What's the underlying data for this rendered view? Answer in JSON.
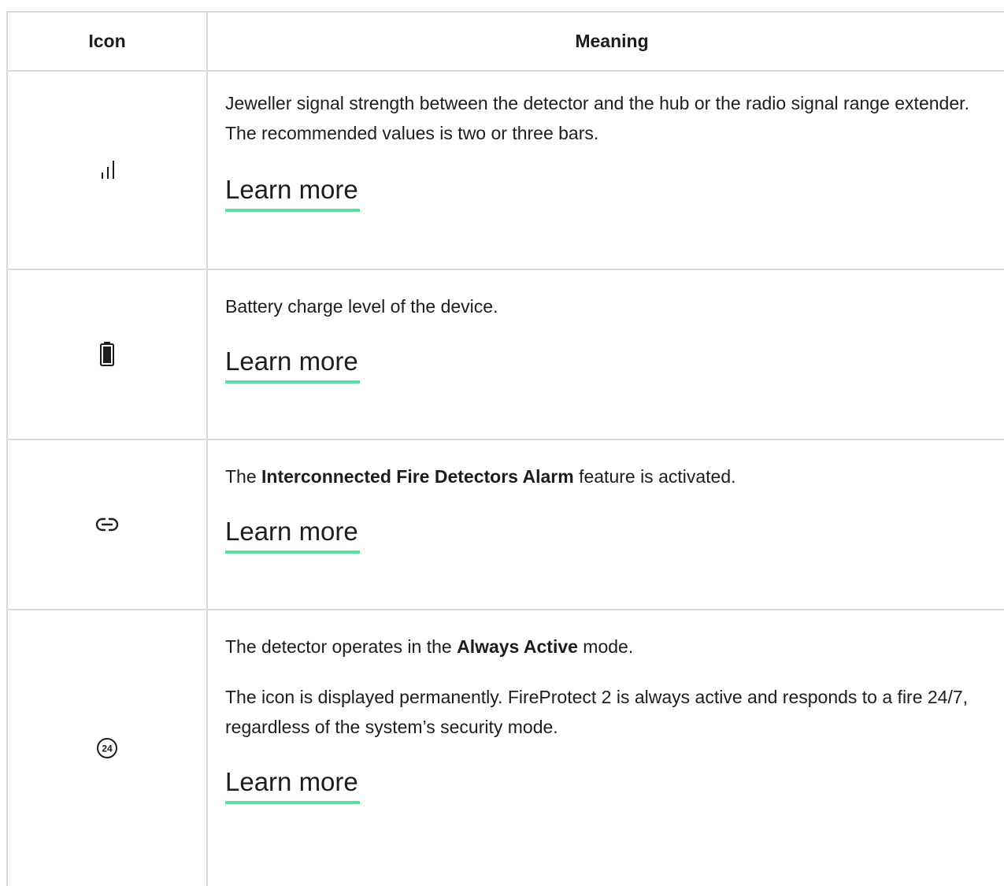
{
  "table": {
    "headers": {
      "icon": "Icon",
      "meaning": "Meaning"
    },
    "rows": [
      {
        "icon_name": "signal-strength-icon",
        "text": "Jeweller signal strength between the detector and the hub or the radio signal range extender. The recommended values is two or three bars.",
        "link": "Learn more"
      },
      {
        "icon_name": "battery-icon",
        "text": "Battery charge level of the device.",
        "link": "Learn more"
      },
      {
        "icon_name": "link-icon",
        "text_before": "The ",
        "text_bold": "Interconnected Fire Detectors Alarm",
        "text_after": " feature is activated.",
        "link": "Learn more"
      },
      {
        "icon_name": "always-active-24-icon",
        "icon_label": "24",
        "text_before": "The detector operates in the ",
        "text_bold": "Always Active",
        "text_after": " mode.",
        "text2": "The icon is displayed permanently. FireProtect 2 is always active and responds to a fire 24/7, regardless of the system’s security mode.",
        "link": "Learn more"
      }
    ]
  },
  "colors": {
    "link_underline": "#5ce0a2",
    "border": "#d9d9d9",
    "text": "#1d1d1d"
  }
}
